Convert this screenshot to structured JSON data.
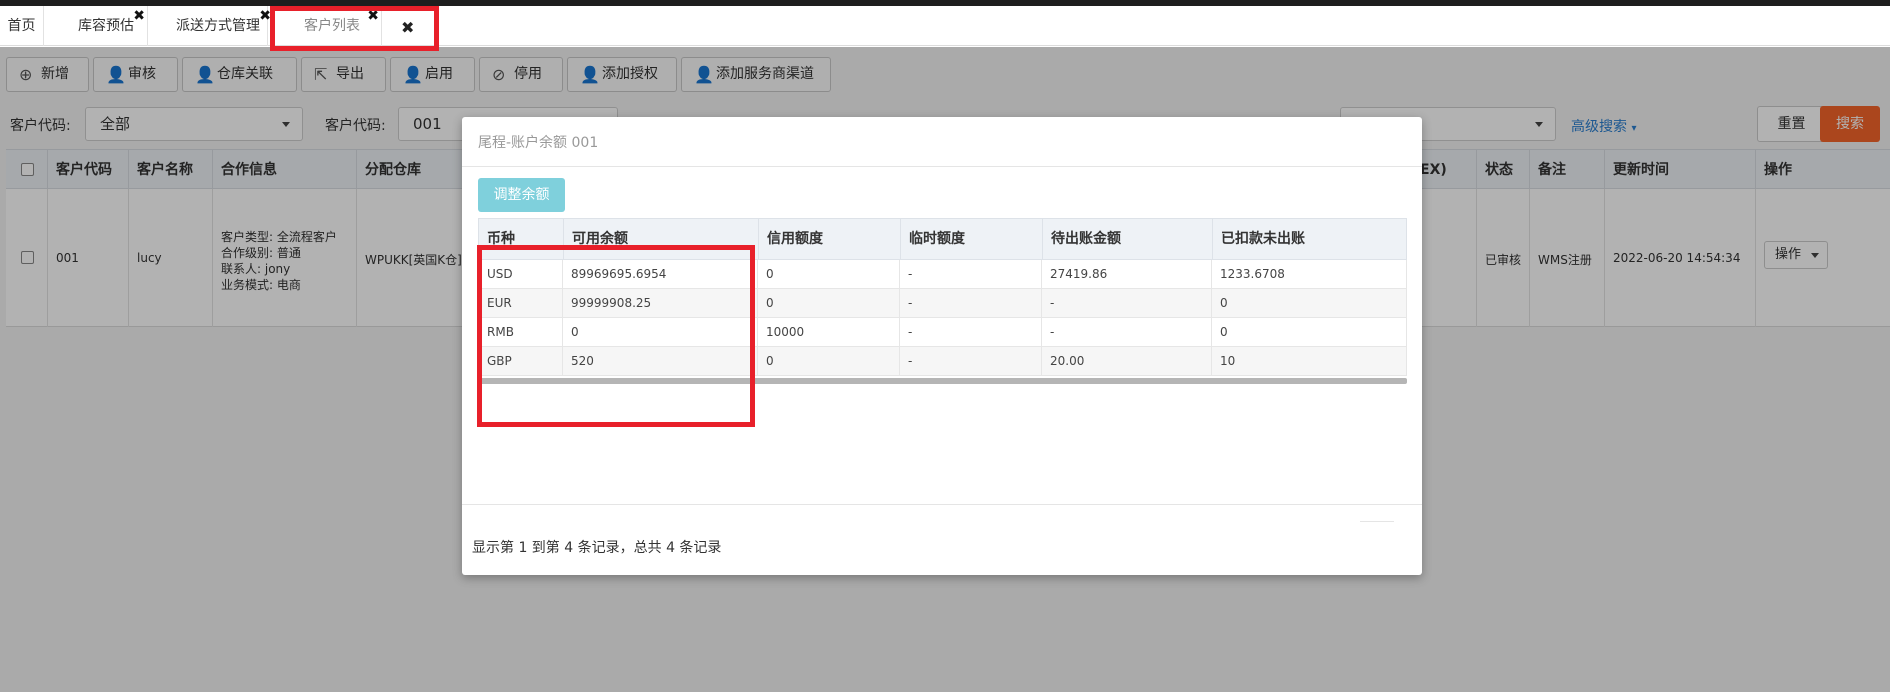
{
  "tabs": [
    {
      "label": "首页",
      "closable": false
    },
    {
      "label": "库容预估",
      "closable": true
    },
    {
      "label": "派送方式管理",
      "closable": true
    },
    {
      "label": "客户列表",
      "closable": true
    }
  ],
  "tab_close_all": "✖",
  "tab_close": "✖",
  "toolbar": {
    "buttons": [
      {
        "label": "新增",
        "icon": "⊕"
      },
      {
        "label": "审核",
        "icon": "👤"
      },
      {
        "label": "仓库关联",
        "icon": "👤"
      },
      {
        "label": "导出",
        "icon": "⇱"
      },
      {
        "label": "启用",
        "icon": "👤"
      },
      {
        "label": "停用",
        "icon": "⊘"
      },
      {
        "label": "添加授权",
        "icon": "👤"
      },
      {
        "label": "添加服务商渠道",
        "icon": "👤"
      }
    ]
  },
  "filters": {
    "label1": "客户代码:",
    "value1": "全部",
    "label2": "客户代码:",
    "value2": "001",
    "advanced_search": "高级搜索",
    "reset": "重置",
    "search": "搜索"
  },
  "grid": {
    "headers": {
      "code": "客户代码",
      "name": "客户名称",
      "coop": "合作信息",
      "warehouse": "分配仓库",
      "ex": "EX)",
      "status": "状态",
      "remark": "备注",
      "updated": "更新时间",
      "ops": "操作"
    },
    "row": {
      "code": "001",
      "name": "lucy",
      "coop_type": "客户类型: 全流程客户",
      "coop_level": "合作级别: 普通",
      "coop_contact": "联系人: jony",
      "coop_mode": "业务模式: 电商",
      "warehouse": "WPUKK[英国K仓],W",
      "status": "已审核",
      "remark": "WMS注册",
      "updated": "2022-06-20 14:54:34",
      "ops": "操作"
    }
  },
  "modal": {
    "title": "尾程-账户余额 001",
    "adjust_button": "调整余额",
    "columns": [
      "币种",
      "可用余额",
      "信用额度",
      "临时额度",
      "待出账金额",
      "已扣款未出账"
    ],
    "rows": [
      [
        "USD",
        "89969695.6954",
        "0",
        "-",
        "27419.86",
        "1233.6708"
      ],
      [
        "EUR",
        "99999908.25",
        "0",
        "-",
        "-",
        "0"
      ],
      [
        "RMB",
        "0",
        "10000",
        "-",
        "-",
        "0"
      ],
      [
        "GBP",
        "520",
        "0",
        "-",
        "20.00",
        "10"
      ]
    ],
    "pager_text": "显示第 1 到第 4 条记录，总共 4 条记录"
  },
  "colors": {
    "highlight": "#e8202a",
    "search_button": "#f5652a",
    "adjust_button": "#7fd0dc",
    "link": "#2a7fd0"
  }
}
